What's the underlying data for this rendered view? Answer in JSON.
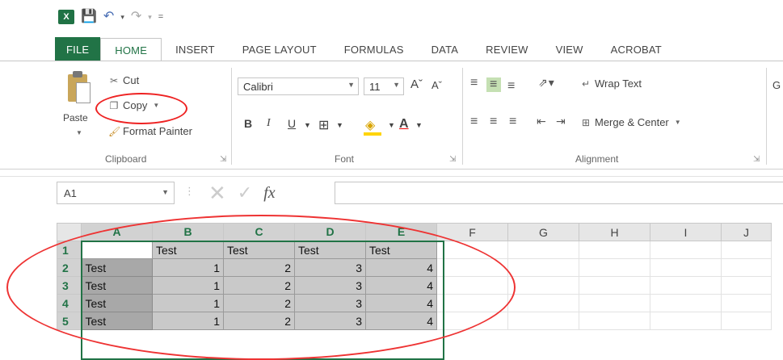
{
  "quick_access": {
    "logo_text": "X",
    "save_icon": "save-icon",
    "undo_icon": "undo-icon",
    "redo_icon": "redo-icon",
    "customize_icon": "customize-icon"
  },
  "tabs": [
    {
      "label": "FILE"
    },
    {
      "label": "HOME"
    },
    {
      "label": "INSERT"
    },
    {
      "label": "PAGE LAYOUT"
    },
    {
      "label": "FORMULAS"
    },
    {
      "label": "DATA"
    },
    {
      "label": "REVIEW"
    },
    {
      "label": "VIEW"
    },
    {
      "label": "ACROBAT"
    }
  ],
  "clipboard": {
    "paste_label": "Paste",
    "cut_label": "Cut",
    "copy_label": "Copy",
    "format_painter_label": "Format Painter",
    "group_label": "Clipboard"
  },
  "font": {
    "font_name": "Calibri",
    "font_size": "11",
    "bold": "B",
    "italic": "I",
    "underline": "U",
    "group_label": "Font"
  },
  "alignment": {
    "wrap_text_label": "Wrap Text",
    "merge_center_label": "Merge & Center",
    "group_label": "Alignment",
    "number_format_partial": "G"
  },
  "formula_bar": {
    "name_box": "A1",
    "fx": "fx",
    "formula": ""
  },
  "sheet": {
    "columns": [
      "A",
      "B",
      "C",
      "D",
      "E",
      "F",
      "G",
      "H",
      "I",
      "J"
    ],
    "rows": [
      {
        "header": "1",
        "cells": [
          "",
          "Test",
          "Test",
          "Test",
          "Test",
          "",
          "",
          "",
          "",
          ""
        ]
      },
      {
        "header": "2",
        "cells": [
          "Test",
          "1",
          "2",
          "3",
          "4",
          "",
          "",
          "",
          "",
          ""
        ]
      },
      {
        "header": "3",
        "cells": [
          "Test",
          "1",
          "2",
          "3",
          "4",
          "",
          "",
          "",
          "",
          ""
        ]
      },
      {
        "header": "4",
        "cells": [
          "Test",
          "1",
          "2",
          "3",
          "4",
          "",
          "",
          "",
          "",
          ""
        ]
      },
      {
        "header": "5",
        "cells": [
          "Test",
          "1",
          "2",
          "3",
          "4",
          "",
          "",
          "",
          "",
          ""
        ]
      }
    ]
  },
  "colors": {
    "accent": "#217346",
    "annotation": "#e22222"
  }
}
